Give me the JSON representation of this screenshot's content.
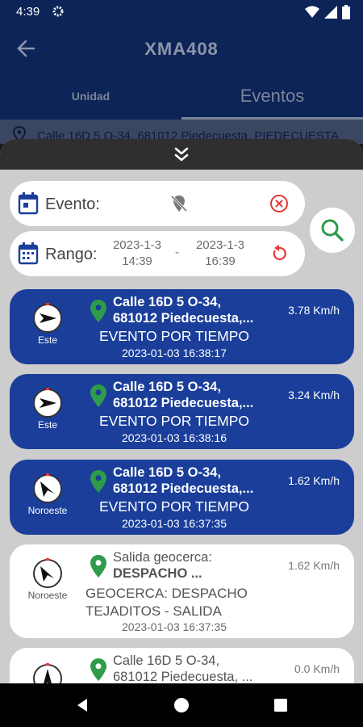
{
  "status": {
    "time": "4:39"
  },
  "appbar": {
    "title": "XMA408"
  },
  "tabs": [
    {
      "label": "Unidad"
    },
    {
      "label": "Eventos"
    }
  ],
  "address_bar": {
    "text": "Calle 16D 5 O-34, 681012 Piedecuesta, PIEDECUESTA"
  },
  "filters": {
    "evento_label": "Evento:",
    "rango_label": "Rango:",
    "date_from": "2023-1-3",
    "time_from": "14:39",
    "separator": "-",
    "date_to": "2023-1-3",
    "time_to": "16:39"
  },
  "events": [
    {
      "dir": "Este",
      "addr1": "Calle 16D 5 O-34,",
      "addr2": "681012 Piedecuesta,...",
      "speed": "3.78 Km/h",
      "evt": "EVENTO POR TIEMPO",
      "ts": "2023-01-03 16:38:17",
      "style": "blue"
    },
    {
      "dir": "Este",
      "addr1": "Calle 16D 5 O-34,",
      "addr2": "681012 Piedecuesta,...",
      "speed": "3.24 Km/h",
      "evt": "EVENTO POR TIEMPO",
      "ts": "2023-01-03 16:38:16",
      "style": "blue"
    },
    {
      "dir": "Noroeste",
      "addr1": "Calle 16D 5 O-34,",
      "addr2": "681012 Piedecuesta,...",
      "speed": "1.62 Km/h",
      "evt": "EVENTO POR TIEMPO",
      "ts": "2023-01-03 16:37:35",
      "style": "blue"
    },
    {
      "dir": "Noroeste",
      "addr1": "Salida geocerca:",
      "addr2": "DESPACHO ...",
      "speed": "1.62 Km/h",
      "evt1": "GEOCERCA: DESPACHO",
      "evt2": "TEJADITOS - SALIDA",
      "ts": "2023-01-03 16:37:35",
      "style": "white"
    },
    {
      "dir": "",
      "addr1": "Calle 16D 5 O-34,",
      "addr2": "681012 Piedecuesta, ...",
      "speed": "0.0 Km/h",
      "style": "white"
    }
  ],
  "colors": {
    "primary": "#0c2457",
    "card_blue": "#1a3e9a",
    "pin_green": "#2e9c4a",
    "alert_red": "#e53935"
  }
}
